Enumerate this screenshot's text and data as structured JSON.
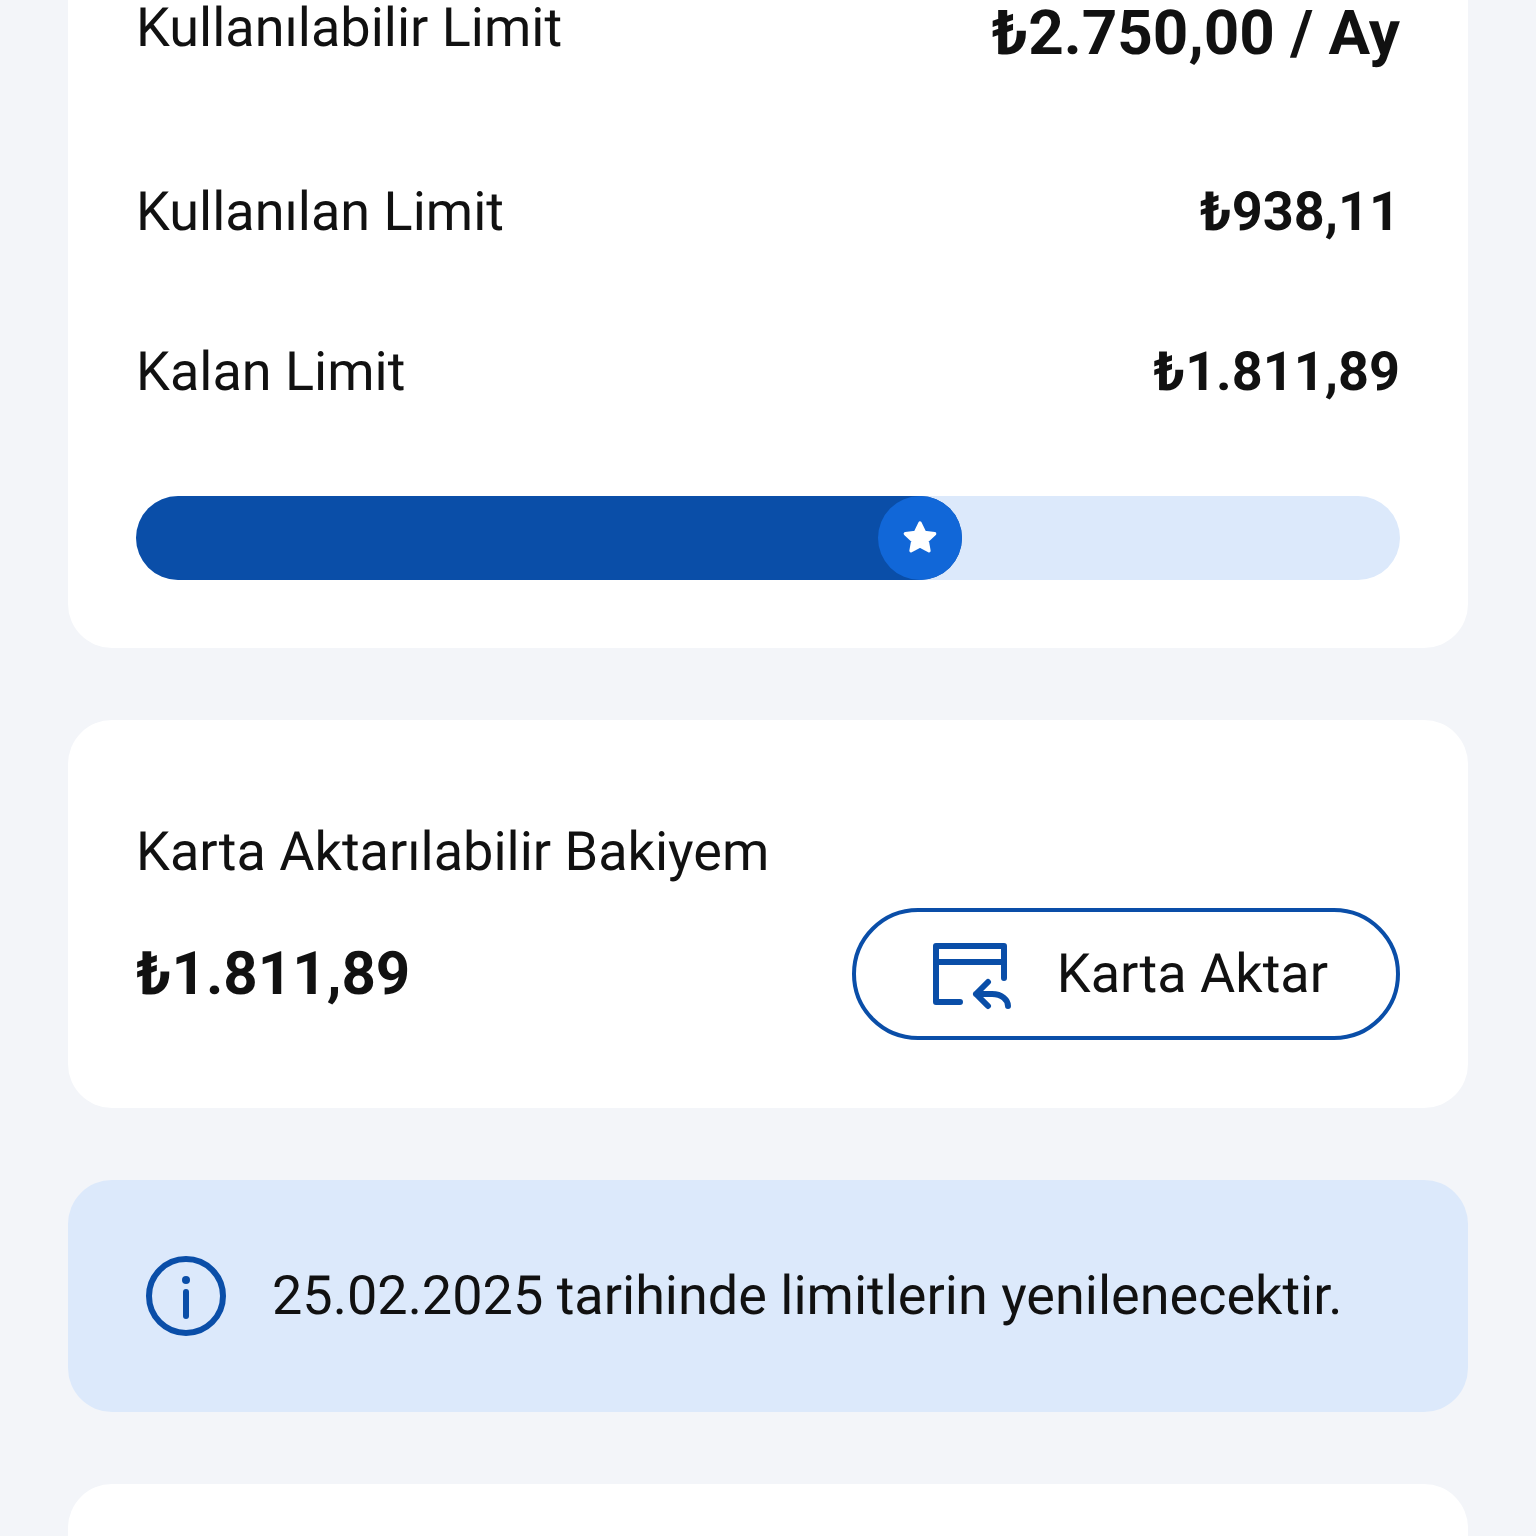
{
  "limits": [
    {
      "label": "Kullanılabilir Limit",
      "value": "₺2.750,00 / Ay",
      "kind": "bold"
    },
    {
      "label": "Kullanılan Limit",
      "value": "₺938,11",
      "kind": "normal"
    },
    {
      "label": "Kalan Limit",
      "value": "₺1.811,89",
      "kind": "normal"
    }
  ],
  "limit_bar": {
    "level": 0.62
  },
  "transfer": {
    "label": "Karta Aktarılabilir Bakiyem",
    "amount": "₺1.811,89",
    "button": "Karta Aktar"
  },
  "info": {
    "text": "25.02.2025 tarihinde limitlerin yenilenecektir."
  }
}
